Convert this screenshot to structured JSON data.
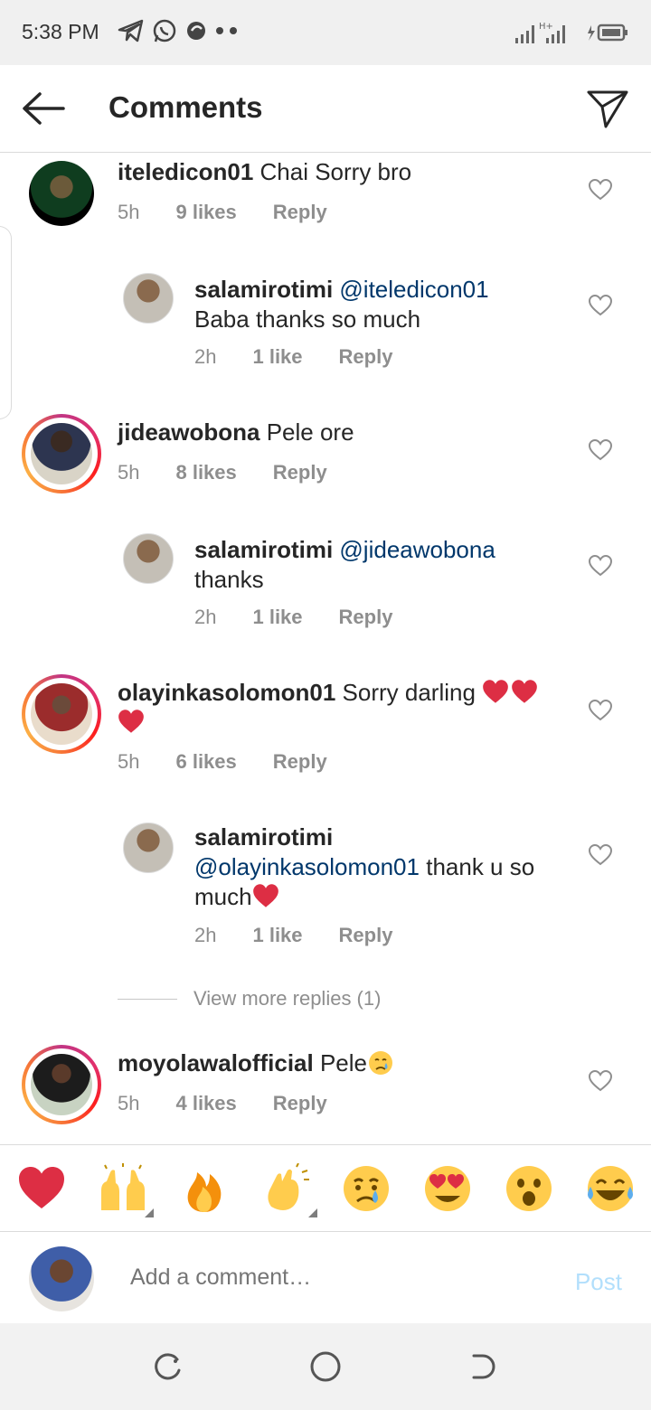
{
  "status_bar": {
    "time": "5:38 PM"
  },
  "header": {
    "title": "Comments"
  },
  "comments": [
    {
      "username": "iteledicon01",
      "text": "Chai Sorry bro",
      "time": "5h",
      "likes": "9 likes",
      "reply": "Reply"
    },
    {
      "username": "salamirotimi",
      "mention": "@iteledicon01",
      "text": "Baba thanks so much",
      "time": "2h",
      "likes": "1 like",
      "reply": "Reply"
    },
    {
      "username": "jideawobona",
      "text": "Pele ore",
      "time": "5h",
      "likes": "8 likes",
      "reply": "Reply"
    },
    {
      "username": "salamirotimi",
      "mention": "@jideawobona",
      "text": "thanks",
      "time": "2h",
      "likes": "1 like",
      "reply": "Reply"
    },
    {
      "username": "olayinkasolomon01",
      "text": "Sorry darling",
      "time": "5h",
      "likes": "6 likes",
      "reply": "Reply"
    },
    {
      "username": "salamirotimi",
      "mention": "@olayinkasolomon01",
      "text": "thank u so much",
      "time": "2h",
      "likes": "1 like",
      "reply": "Reply"
    },
    {
      "username": "moyolawalofficial",
      "text": "Pele",
      "time": "5h",
      "likes": "4 likes",
      "reply": "Reply"
    }
  ],
  "view_more_replies": "View more replies (1)",
  "emoji_bar": [
    "red-heart",
    "raising-hands",
    "fire",
    "clapping-hands",
    "crying-face",
    "heart-eyes-face",
    "astonished-face",
    "tears-of-joy-face"
  ],
  "composer": {
    "placeholder": "Add a comment…",
    "post_label": "Post"
  },
  "colors": {
    "link": "#00376b",
    "meta": "#8e8e8e",
    "post_disabled": "#b2dffc",
    "heart": "#ed4956"
  }
}
